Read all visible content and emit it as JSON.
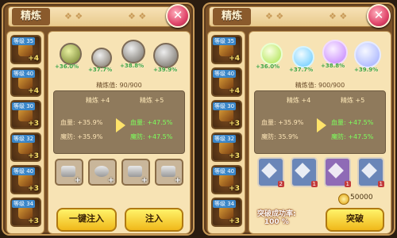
{
  "left": {
    "title": "精炼",
    "close_glyph": "✕",
    "sidebar": [
      {
        "level": "等级 35",
        "plus": "+4"
      },
      {
        "level": "等级 40",
        "plus": "+4"
      },
      {
        "level": "等级 30",
        "plus": "+3"
      },
      {
        "level": "等级 32",
        "plus": "+3"
      },
      {
        "level": "等级 40",
        "plus": "+3"
      },
      {
        "level": "等级 34",
        "plus": "+3"
      }
    ],
    "orbs": [
      {
        "pct": "+36.0%",
        "color": "#6f7d2a"
      },
      {
        "pct": "+37.7%",
        "color": "#7d7466"
      },
      {
        "pct": "+38.8%",
        "color": "#6f6a62"
      },
      {
        "pct": "+39.9%",
        "color": "#6b655c"
      }
    ],
    "refine_value": "精炼值: 90/900",
    "current_header": "精炼 +4",
    "next_header": "精炼 +5",
    "stats": [
      {
        "label": "血量: +35.9%",
        "next": "血量: +47.5%"
      },
      {
        "label": "魔防: +35.9%",
        "next": "魔防: +47.5%"
      }
    ],
    "materials_plus": "+",
    "buttons": {
      "one_click": "一键注入",
      "inject": "注入"
    }
  },
  "right": {
    "title": "精炼",
    "close_glyph": "✕",
    "sidebar": [
      {
        "level": "等级 35",
        "plus": "+4"
      },
      {
        "level": "等级 40",
        "plus": "+4"
      },
      {
        "level": "等级 30",
        "plus": "+3"
      },
      {
        "level": "等级 32",
        "plus": "+3"
      },
      {
        "level": "等级 40",
        "plus": "+3"
      },
      {
        "level": "等级 34",
        "plus": "+3"
      }
    ],
    "orbs": [
      {
        "pct": "+36.0%",
        "color": "#a8e24a"
      },
      {
        "pct": "+37.7%",
        "color": "#5ec8ff"
      },
      {
        "pct": "+38.8%",
        "color": "#c07cff"
      },
      {
        "pct": "+39.9%",
        "color": "#9aa8ff"
      }
    ],
    "refine_value": "精炼值: 900/900",
    "current_header": "精炼 +4",
    "next_header": "精炼 +5",
    "stats": [
      {
        "label": "血量: +35.9%",
        "next": "血量: +47.5%"
      },
      {
        "label": "魔防: 35.9%",
        "next": "魔防: +47.5%"
      }
    ],
    "cards": [
      {
        "badge": "2",
        "purple": false
      },
      {
        "badge": "1",
        "purple": false
      },
      {
        "badge": "1",
        "purple": true
      },
      {
        "badge": "1",
        "purple": false
      }
    ],
    "gold": "50000",
    "success_rate_label": "突破成功率:",
    "success_rate_value": "100 %",
    "breakthrough_button": "突破"
  }
}
